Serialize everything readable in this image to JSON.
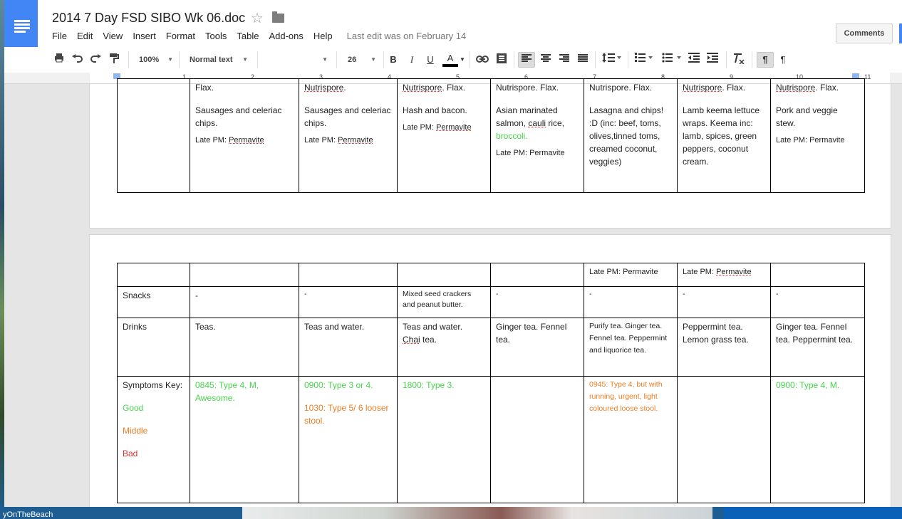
{
  "doc": {
    "title": "2014 7 Day FSD SIBO Wk 06.doc",
    "menu": [
      "File",
      "Edit",
      "View",
      "Insert",
      "Format",
      "Tools",
      "Table",
      "Add-ons",
      "Help"
    ],
    "last_edit": "Last edit was on February 14",
    "comments_label": "Comments"
  },
  "toolbar": {
    "zoom": "100%",
    "style": "Normal text",
    "font_size": "26",
    "icons": [
      "print-icon",
      "undo-icon",
      "redo-icon",
      "paint-format-icon",
      "bold-icon",
      "italic-icon",
      "underline-icon",
      "text-color-icon",
      "link-icon",
      "comment-icon",
      "align-left-icon",
      "align-center-icon",
      "align-right-icon",
      "justify-icon",
      "line-spacing-icon",
      "numbered-list-icon",
      "bulleted-list-icon",
      "decrease-indent-icon",
      "increase-indent-icon",
      "clear-formatting-icon",
      "ltr-icon",
      "rtl-icon"
    ],
    "glyphs": {
      "bold": "B",
      "italic": "I",
      "underline": "U",
      "color": "A"
    }
  },
  "ruler": {
    "numbers": [
      "1",
      "2",
      "3",
      "4",
      "5",
      "6",
      "7",
      "8",
      "9",
      "10",
      "11"
    ]
  },
  "page1": {
    "dinner": [
      {
        "flax": "Flax.",
        "meal": "Sausages and celeriac chips.",
        "late_prefix": "Late PM: ",
        "late_word": "Permavite"
      },
      {
        "flax_word": "Nutrispore",
        "flax_rest": ".",
        "meal": "Sausages and celeriac chips.",
        "late_prefix": "Late PM: ",
        "late_word": "Permavite"
      },
      {
        "flax_word": "Nutrispore",
        "flax_rest": ". Flax.",
        "meal": "Hash and bacon.",
        "late_prefix": "Late PM: ",
        "late_word": "Permavite"
      },
      {
        "flax": "Nutrispore. Flax.",
        "meal_a": "Asian marinated salmon, ",
        "meal_b": "cauli",
        "meal_c": " rice, ",
        "meal_green": "broccoli.",
        "late": "Late PM: Permavite"
      },
      {
        "flax": "Nutrispore. Flax.",
        "meal": "Lasagna and chips! :D (inc: beef, toms, olives,tinned toms, creamed coconut, veggies)"
      },
      {
        "flax_word": "Nutrispore",
        "flax_rest": ". Flax.",
        "meal": "Lamb keema lettuce wraps. Keema inc: lamb, spices, green peppers, coconut cream."
      },
      {
        "flax_word": "Nutrispore",
        "flax_rest": ". Flax.",
        "meal": "Pork and veggie stew.",
        "late": "Late PM: Permavite"
      }
    ]
  },
  "page2": {
    "late_row": {
      "wed": "Late PM: Permavite",
      "thu_prefix": "Late PM: ",
      "thu_word": "Permavite"
    },
    "snacks": {
      "label": "Snacks",
      "cells": [
        "-",
        "-",
        "Mixed seed crackers and peanut butter.",
        "-",
        "-",
        "-",
        "-"
      ]
    },
    "drinks": {
      "label": "Drinks",
      "cells": [
        "Teas.",
        "Teas and water.",
        "Teas and water.",
        "Ginger tea. Fennel tea.",
        "Purify tea.  Ginger tea. Fennel tea. Peppermint and liquorice tea.",
        "Peppermint tea. Lemon grass tea.",
        "Ginger tea. Fennel tea. Peppermint tea."
      ],
      "chai_word": "Chai",
      "chai_rest": " tea."
    },
    "symptoms": {
      "label": "Symptoms Key:",
      "good": "Good",
      "middle": "Middle",
      "bad": "Bad",
      "c1": "0845: Type 4, M, Awesome.",
      "c2a": "0900: Type 3 or 4.",
      "c2b": "1030: Type 5/ 6 looser stool.",
      "c3": "1800: Type 3.",
      "c5": "0945: Type 4, but with running, urgent, light coloured loose stool.",
      "c7": "0900: Type 4, M."
    }
  },
  "taskbar": {
    "label": "yOnTheBeach"
  }
}
